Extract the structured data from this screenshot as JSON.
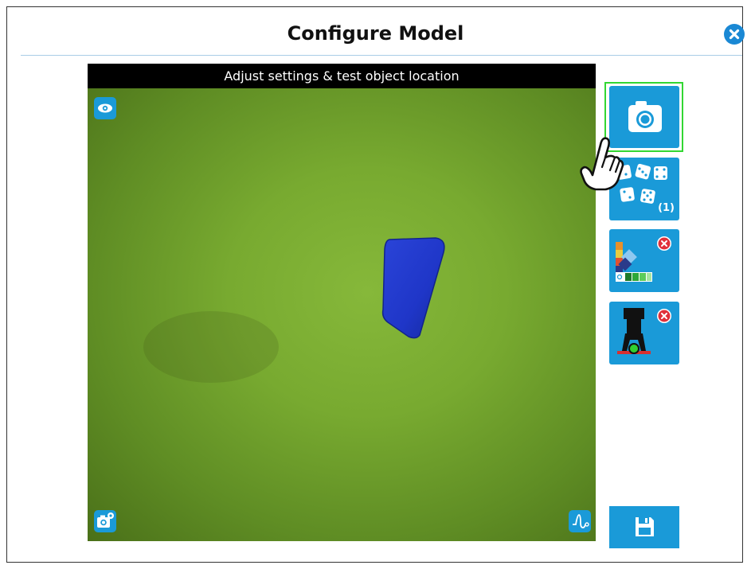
{
  "dialog": {
    "title": "Configure Model"
  },
  "camera": {
    "header": "Adjust settings & test object location"
  },
  "toolbar": {
    "capture_icon": "camera-icon",
    "dice_icon": "dice-icon",
    "dice_count": "(1)",
    "color_palette_icon": "color-palette-icon",
    "gripper_icon": "gripper-icon",
    "save_icon": "save-icon"
  },
  "overlay": {
    "view_icon": "eye-icon",
    "camera_settings_icon": "camera-settings-icon",
    "signal_icon": "waveform-icon"
  },
  "colors": {
    "accent": "#1a9ad8",
    "highlight": "#32d732",
    "remove_badge": "#e0303a",
    "object": "#1f36c8"
  }
}
